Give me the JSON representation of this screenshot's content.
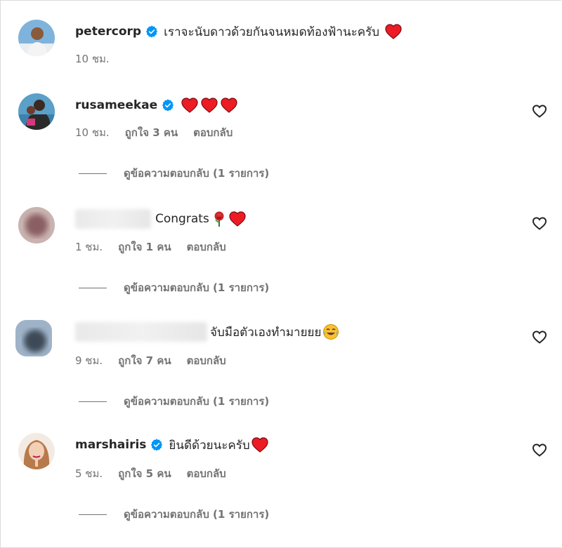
{
  "comments": [
    {
      "username": "petercorp",
      "verified": true,
      "text": "เราจะนับดาวด้วยกันจนหมดท้องฟ้านะครับ",
      "hearts": 1,
      "time": "10 ชม."
    },
    {
      "username": "rusameekae",
      "verified": true,
      "text": "",
      "hearts": 3,
      "time": "10 ชม.",
      "likes": "ถูกใจ 3 คน",
      "reply": "ตอบกลับ",
      "view_replies": "ดูข้อความตอบกลับ (1 รายการ)"
    },
    {
      "username": "",
      "verified": false,
      "text": "Congrats",
      "emoji": "rose-emoji",
      "hearts": 1,
      "time": "1 ชม.",
      "likes": "ถูกใจ 1 คน",
      "reply": "ตอบกลับ",
      "view_replies": "ดูข้อความตอบกลับ (1 รายการ)"
    },
    {
      "username": "",
      "verified": false,
      "text": "จับมือตัวเองทำมายยย",
      "emoji": "tears-of-joy-emoji",
      "hearts": 0,
      "time": "9 ชม.",
      "likes": "ถูกใจ 7 คน",
      "reply": "ตอบกลับ",
      "view_replies": "ดูข้อความตอบกลับ (1 รายการ)"
    },
    {
      "username": "marshairis",
      "verified": true,
      "text": "ยินดีด้วยนะครับ",
      "hearts": 1,
      "time": "5 ชม.",
      "likes": "ถูกใจ 5 คน",
      "reply": "ตอบกลับ",
      "view_replies": "ดูข้อความตอบกลับ (1 รายการ)"
    }
  ],
  "colors": {
    "verified": "#0095f6",
    "heart": "#ed1c24",
    "meta_text": "#737373",
    "text": "#262626"
  }
}
